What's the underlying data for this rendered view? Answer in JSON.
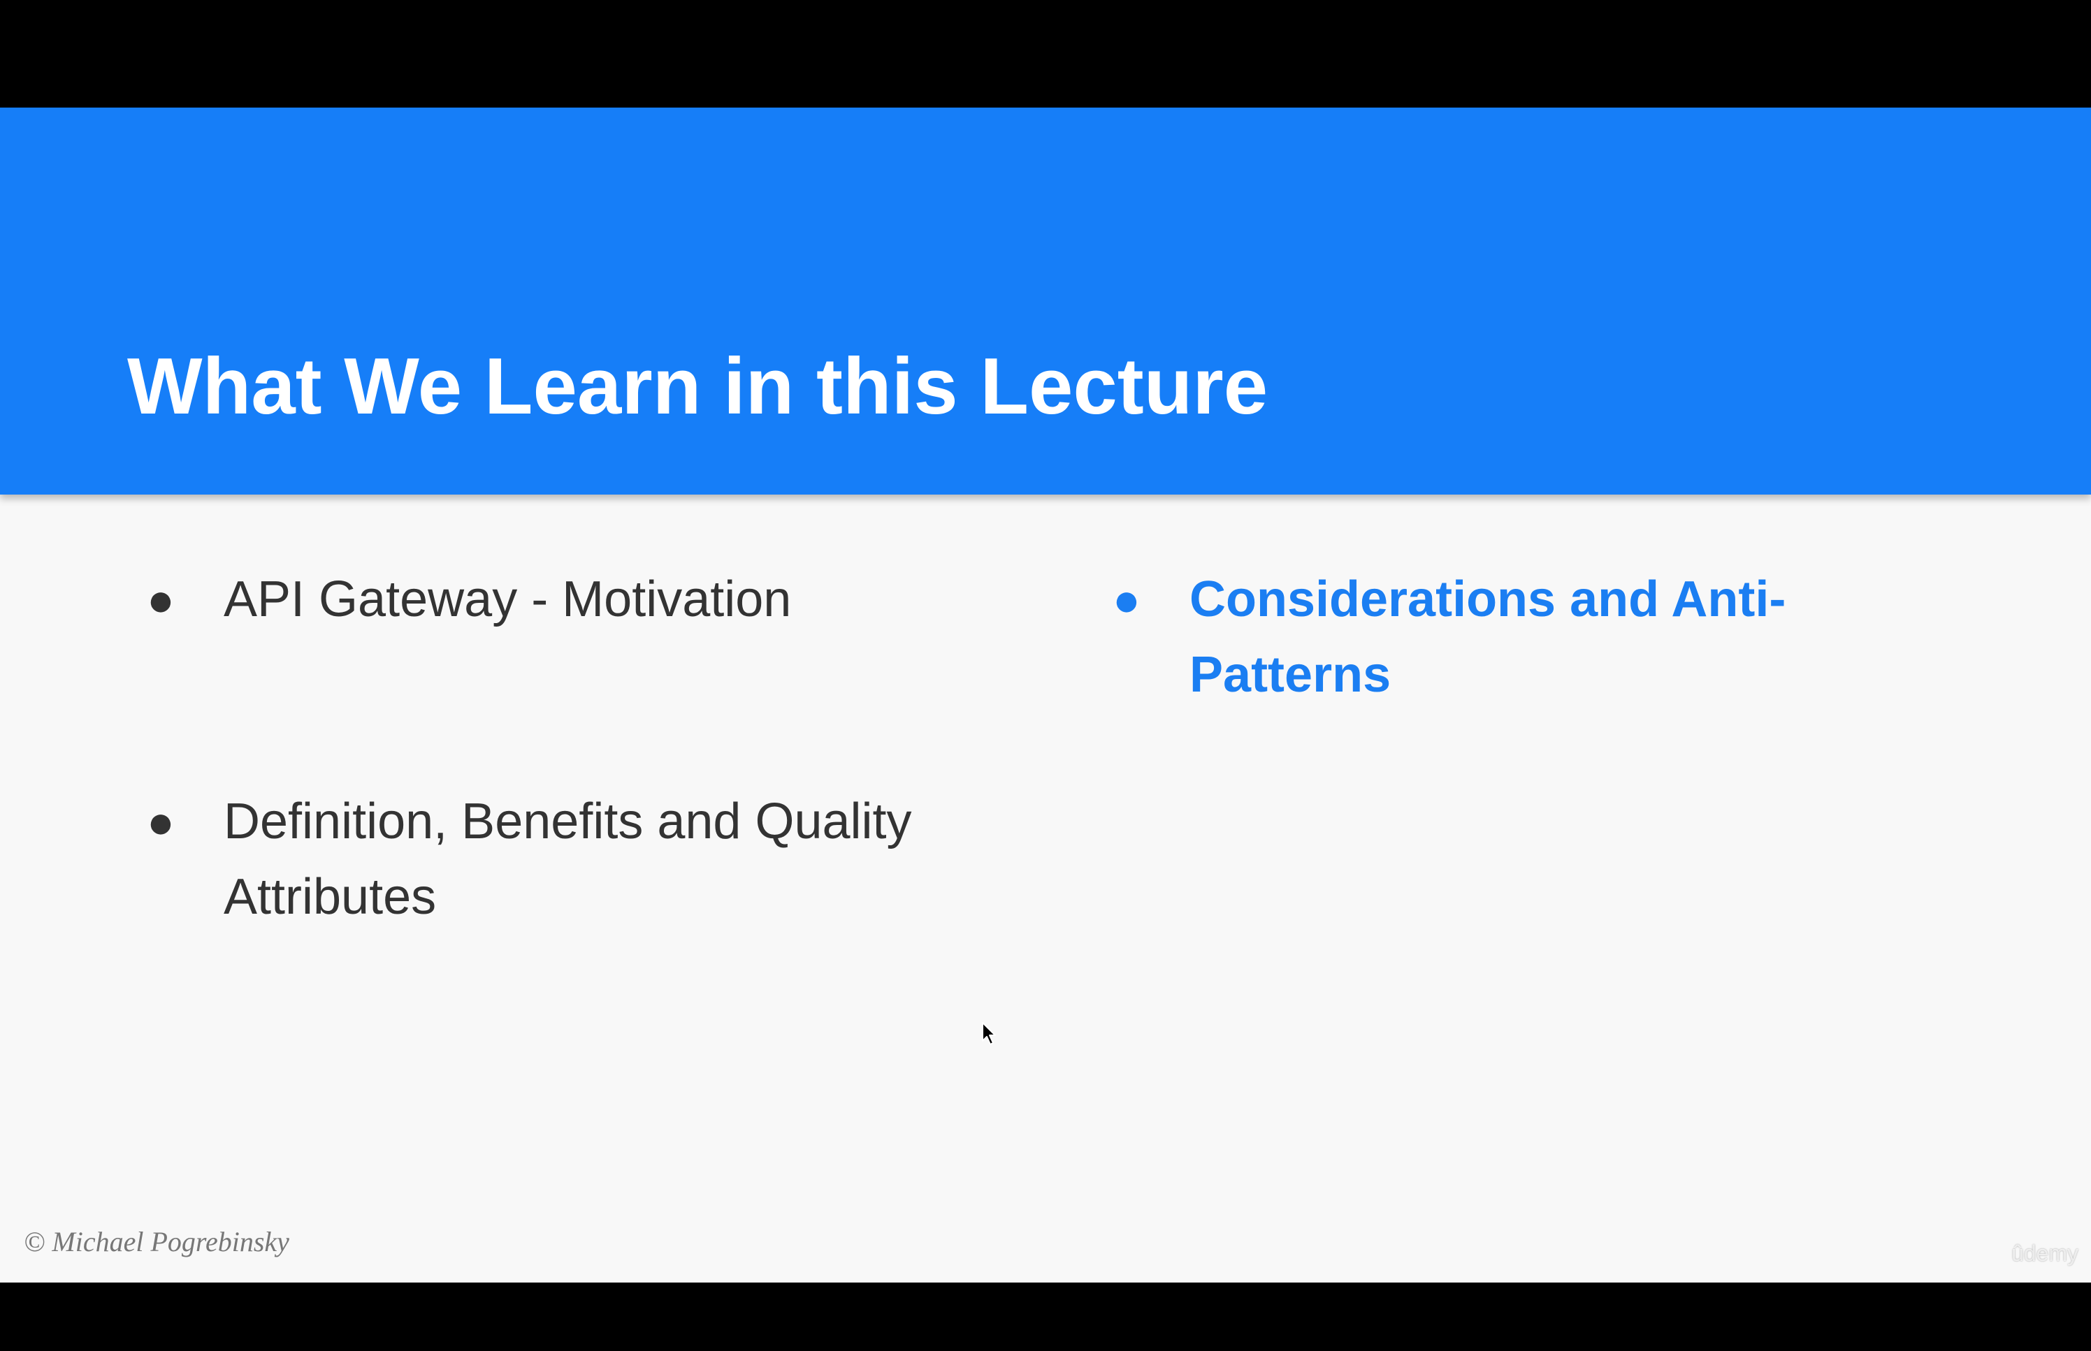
{
  "slide": {
    "title": "What We Learn in this Lecture",
    "bullets": [
      {
        "text": "API Gateway - Motivation"
      },
      {
        "text": "Definition, Benefits and Quality Attributes"
      },
      {
        "text": "Considerations and Anti-Patterns"
      }
    ],
    "bullet_symbol": "●",
    "copyright": "© Michael Pogrebinsky",
    "watermark": "ûdemy"
  },
  "colors": {
    "header": "#167ef8",
    "body_text": "#333333",
    "active_bullet": "#1b7ef2",
    "slide_bg": "#f8f8f8",
    "frame_bg": "#000000"
  },
  "icons": {
    "cursor": "mouse-pointer-icon"
  }
}
